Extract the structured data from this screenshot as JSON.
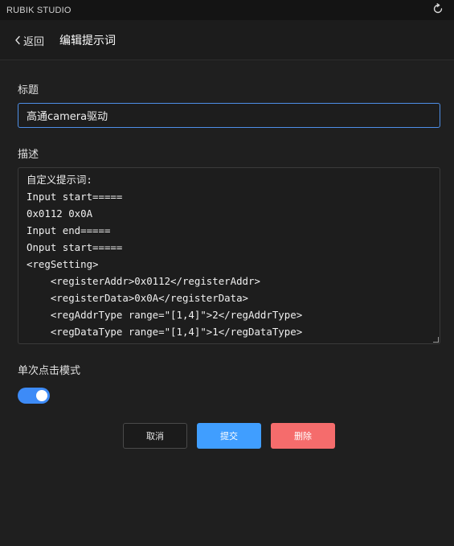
{
  "app": {
    "name": "RUBIK STUDIO"
  },
  "header": {
    "back_label": "返回",
    "title": "编辑提示词"
  },
  "form": {
    "title_label": "标题",
    "title_value": "高通camera驱动",
    "desc_label": "描述",
    "desc_lines": [
      "自定义提示词:",
      "Input start=====",
      "0x0112 0x0A",
      "Input end=====",
      "Onput start=====",
      "<regSetting>",
      "    <registerAddr>0x0112</registerAddr>",
      "    <registerData>0x0A</registerData>",
      "    <regAddrType range=\"[1,4]\">2</regAddrType>",
      "    <regDataType range=\"[1,4]\">1</regDataType>"
    ],
    "single_click_label": "单次点击模式",
    "single_click_enabled": true
  },
  "buttons": {
    "cancel": "取消",
    "submit": "提交",
    "delete": "删除"
  },
  "colors": {
    "accent": "#409eff",
    "danger": "#f56c6c",
    "toggle_on": "#3d8bf7",
    "input_focus_border": "#4e8fe8"
  },
  "icons": {
    "refresh": "refresh-icon",
    "back": "chevron-left-icon"
  }
}
